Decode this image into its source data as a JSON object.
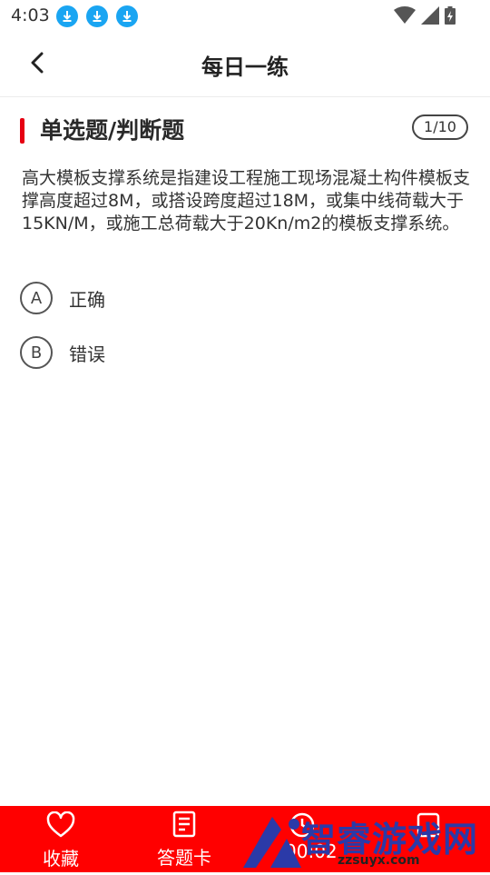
{
  "status_bar": {
    "time": "4:03",
    "notification_icons": [
      "download-icon",
      "download-icon",
      "download-icon"
    ],
    "system_icons": [
      "wifi-icon",
      "signal-icon",
      "battery-charging-icon"
    ]
  },
  "header": {
    "title": "每日一练",
    "back_icon": "chevron-left-icon"
  },
  "question": {
    "type": "单选题/判断题",
    "progress": "1/10",
    "text": "高大模板支撑系统是指建设工程施工现场混凝土构件模板支撑高度超过8M，或搭设跨度超过18M，或集中线荷载大于15KN/M，或施工总荷载大于20Kn/m2的模板支撑系统。",
    "options": [
      {
        "letter": "A",
        "label": "正确"
      },
      {
        "letter": "B",
        "label": "错误"
      }
    ]
  },
  "bottom_bar": {
    "background": "#ff0000",
    "tabs": [
      {
        "icon": "heart-icon",
        "label": "收藏"
      },
      {
        "icon": "answer-card-icon",
        "label": "答题卡"
      }
    ],
    "timer": "00:02"
  },
  "watermark": {
    "text": "智睿游戏网",
    "url": "zzsuyx.com"
  }
}
